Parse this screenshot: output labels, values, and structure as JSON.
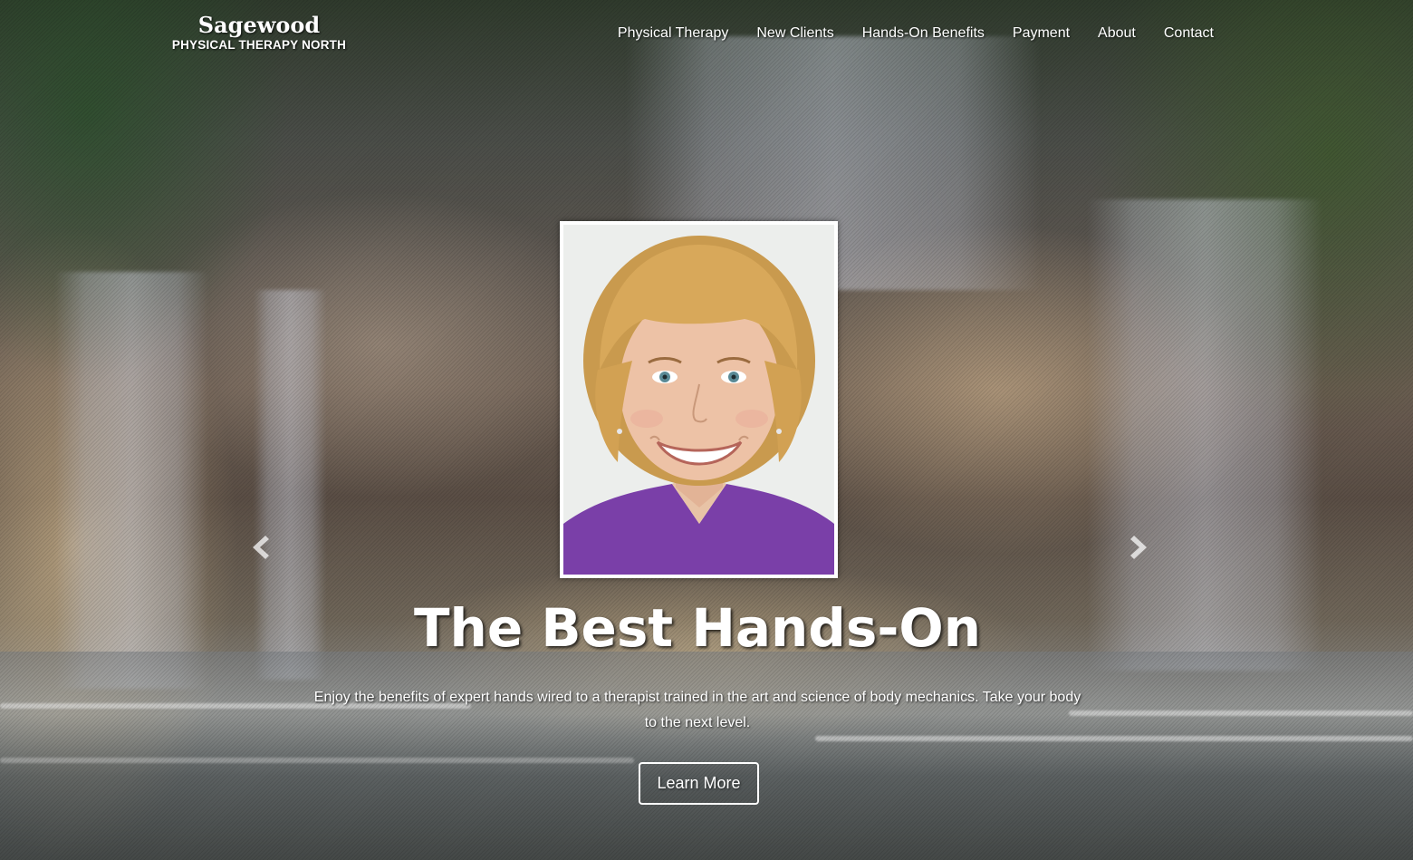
{
  "brand": {
    "name": "Sagewood",
    "subtitle": "PHYSICAL THERAPY NORTH"
  },
  "nav": {
    "items": [
      {
        "label": "Physical Therapy"
      },
      {
        "label": "New Clients"
      },
      {
        "label": "Hands-On Benefits"
      },
      {
        "label": "Payment"
      },
      {
        "label": "About"
      },
      {
        "label": "Contact"
      }
    ]
  },
  "hero": {
    "headline": "The Best Hands-On",
    "lead": "Enjoy the benefits of expert hands wired to a therapist trained in the art and science of body mechanics. Take your body to the next level.",
    "cta_label": "Learn More",
    "portrait_icon": "portrait-photo"
  },
  "carousel": {
    "prev_icon": "chevron-left-icon",
    "next_icon": "chevron-right-icon"
  },
  "colors": {
    "text": "#ffffff",
    "portrait_shirt": "#7a3fa8",
    "portrait_hair": "#d8a85a"
  }
}
